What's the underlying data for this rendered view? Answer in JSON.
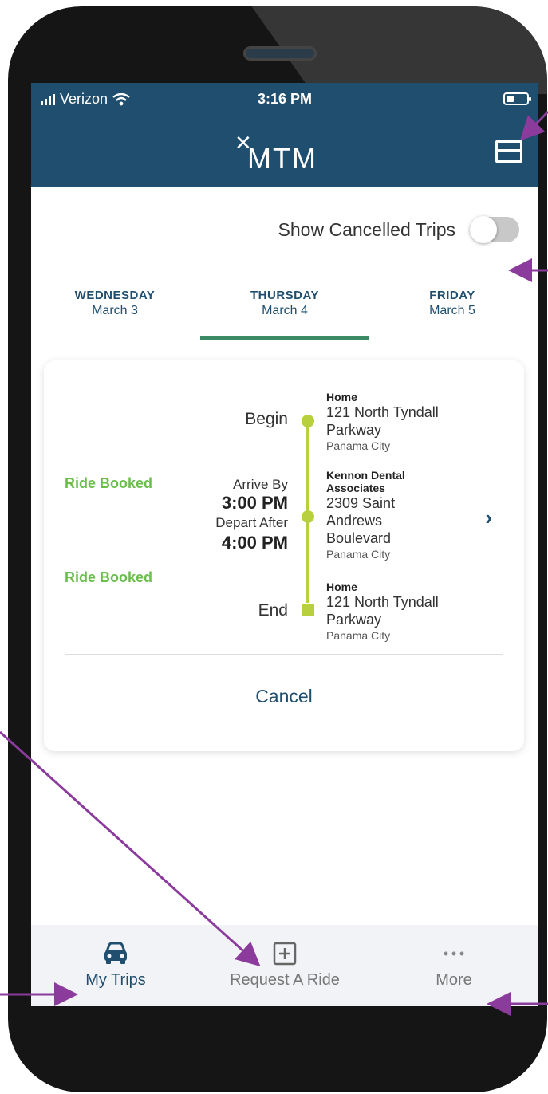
{
  "status_bar": {
    "carrier": "Verizon",
    "time": "3:16 PM"
  },
  "brand": {
    "logo_text": "MTM",
    "mark": "✕"
  },
  "colors": {
    "header": "#1f4e6f",
    "accent_green": "#6bbd4c",
    "timeline": "#b8cf3e",
    "tab_underline": "#3c8a66",
    "annotation_arrow": "#8a3b9c"
  },
  "toggle": {
    "label": "Show Cancelled Trips",
    "state": "off"
  },
  "days": [
    {
      "name": "WEDNESDAY",
      "date": "March 3"
    },
    {
      "name": "THURSDAY",
      "date": "March 4"
    },
    {
      "name": "FRIDAY",
      "date": "March 5"
    }
  ],
  "selected_day": "THURSDAY",
  "trip": {
    "status_1": "Ride Booked",
    "status_2": "Ride Booked",
    "begin_label": "Begin",
    "arrive_by_label": "Arrive By",
    "arrive_by_time": "3:00 PM",
    "depart_after_label": "Depart After",
    "depart_after_time": "4:00 PM",
    "end_label": "End",
    "stops": [
      {
        "title": "Home",
        "addr1": "121 North Tyndall",
        "addr2": "Parkway",
        "city": "Panama City"
      },
      {
        "title1": "Kennon Dental",
        "title2": "Associates",
        "addr1": "2309 Saint",
        "addr2": "Andrews",
        "addr3": "Boulevard",
        "city": "Panama City"
      },
      {
        "title": "Home",
        "addr1": "121 North Tyndall",
        "addr2": "Parkway",
        "city": "Panama City"
      }
    ],
    "cancel_label": "Cancel"
  },
  "tabs": [
    {
      "label": "My Trips",
      "icon": "car-icon",
      "active": true
    },
    {
      "label": "Request A Ride",
      "icon": "plus-square-icon",
      "active": false
    },
    {
      "label": "More",
      "icon": "ellipsis-icon",
      "active": false
    }
  ]
}
